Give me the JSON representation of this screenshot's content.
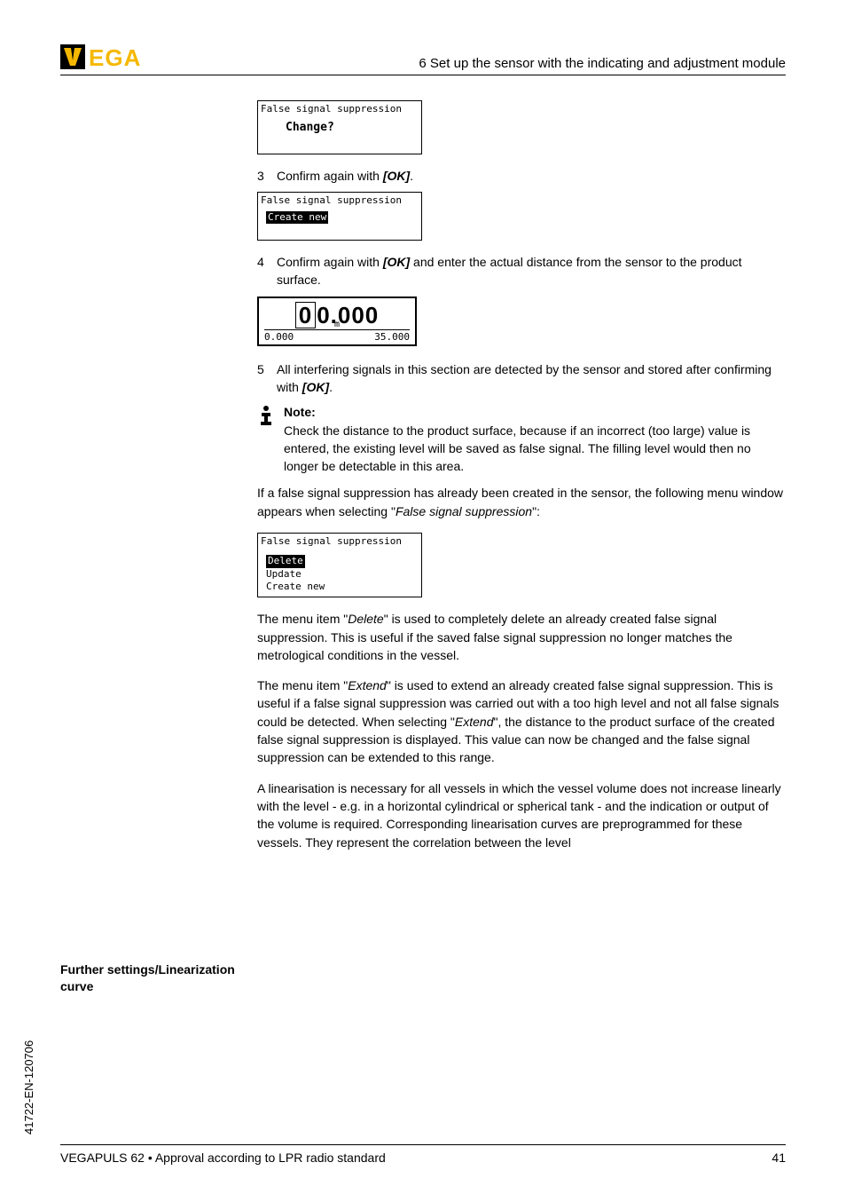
{
  "header": {
    "section": "6   Set up the sensor with the indicating and adjustment module"
  },
  "lcd1": {
    "title": "False signal suppression",
    "change": "Change?"
  },
  "step3": {
    "num": "3",
    "text_before": "Confirm again with ",
    "ok": "[OK]",
    "text_after": "."
  },
  "lcd2": {
    "title": "False signal suppression",
    "item": "Create new"
  },
  "step4": {
    "num": "4",
    "text_before": "Confirm again with ",
    "ok": "[OK]",
    "text_after": " and enter the actual distance from the sensor to the product surface."
  },
  "numeric": {
    "boxed": "0",
    "rest": "0.000",
    "left": "0.000",
    "unit": "m",
    "right": "35.000"
  },
  "step5": {
    "num": "5",
    "text_before": "All interfering signals in this section are detected by the sensor and stored after confirming with ",
    "ok": "[OK]",
    "text_after": "."
  },
  "note": {
    "head": "Note:",
    "body": "Check the distance to the product surface, because if an incorrect (too large) value is entered, the existing level will be saved as false signal. The filling level would then no longer be detectable in this area."
  },
  "para1": {
    "a": "If a false signal suppression has already been created in the sensor, the following menu window appears when selecting \"",
    "i": "False signal suppression",
    "b": "\":"
  },
  "lcd3": {
    "title": "False signal suppression",
    "item1": "Delete",
    "item2": "Update",
    "item3": "Create new"
  },
  "para2": {
    "a": "The menu item \"",
    "i": "Delete",
    "b": "\" is used to completely delete an already created false signal suppression. This is useful if the saved false signal suppression no longer matches the metrological conditions in the vessel."
  },
  "para3": {
    "a": "The menu item \"",
    "i1": "Extend",
    "b": "\" is used to extend an already created false signal suppression. This is useful if a false signal suppression was carried out with a too high level and not all false signals could be detected. When selecting \"",
    "i2": "Extend",
    "c": "\", the distance to the product surface of the created false signal suppression is displayed. This value can now be changed and the false signal suppression can be extended to this range."
  },
  "side": {
    "label": "Further settings/Linearization curve"
  },
  "para4": "A linearisation is necessary for all vessels in which the vessel volume does not increase linearly with the level - e.g. in a horizontal cylindrical or spherical tank - and the indication or output of the volume is required. Corresponding linearisation curves are preprogrammed for these vessels. They represent the correlation between the level",
  "docid": "41722-EN-120706",
  "footer": {
    "left": "VEGAPULS 62 • Approval according to LPR radio standard",
    "right": "41"
  }
}
